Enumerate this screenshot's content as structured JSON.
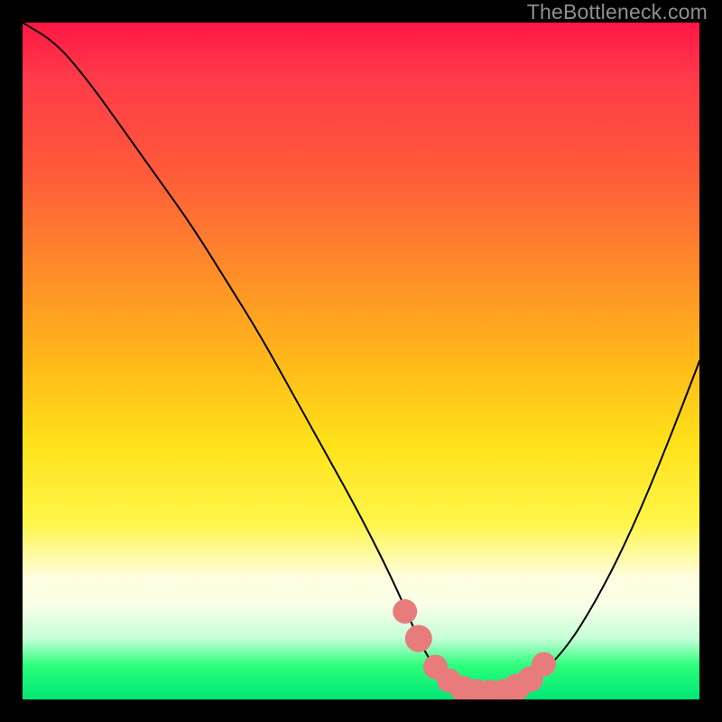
{
  "watermark": "TheBottleneck.com",
  "chart_data": {
    "type": "line",
    "title": "",
    "xlabel": "",
    "ylabel": "",
    "xlim": [
      0,
      100
    ],
    "ylim": [
      0,
      100
    ],
    "grid": false,
    "series": [
      {
        "name": "bottleneck-curve",
        "x": [
          0,
          5,
          10,
          15,
          20,
          25,
          30,
          35,
          40,
          45,
          50,
          55,
          58,
          60,
          62,
          65,
          68,
          70,
          72,
          75,
          80,
          85,
          90,
          95,
          100
        ],
        "values": [
          100,
          97,
          91,
          84,
          77,
          70,
          62,
          54,
          45,
          36,
          27,
          17,
          10,
          6,
          3.5,
          1.5,
          1,
          1,
          1.2,
          2.5,
          7,
          15,
          25,
          37,
          50
        ]
      }
    ],
    "markers": {
      "name": "highlight-dots",
      "color": "#e87c7c",
      "points": [
        {
          "x": 56.5,
          "y": 13,
          "r": 1.8
        },
        {
          "x": 58.5,
          "y": 9,
          "r": 2.0
        },
        {
          "x": 61,
          "y": 4.8,
          "r": 1.8
        },
        {
          "x": 63,
          "y": 2.8,
          "r": 1.8
        },
        {
          "x": 65,
          "y": 1.6,
          "r": 1.9
        },
        {
          "x": 67,
          "y": 1.1,
          "r": 1.9
        },
        {
          "x": 69,
          "y": 1.0,
          "r": 1.9
        },
        {
          "x": 71,
          "y": 1.1,
          "r": 1.9
        },
        {
          "x": 73,
          "y": 1.8,
          "r": 2.0
        },
        {
          "x": 75,
          "y": 3.0,
          "r": 1.9
        },
        {
          "x": 77,
          "y": 5.2,
          "r": 1.8
        }
      ]
    },
    "gradient_stops": [
      {
        "pos": 0,
        "color": "#ff1744"
      },
      {
        "pos": 50,
        "color": "#ffe11a"
      },
      {
        "pos": 82,
        "color": "#fffde0"
      },
      {
        "pos": 100,
        "color": "#00e676"
      }
    ]
  }
}
